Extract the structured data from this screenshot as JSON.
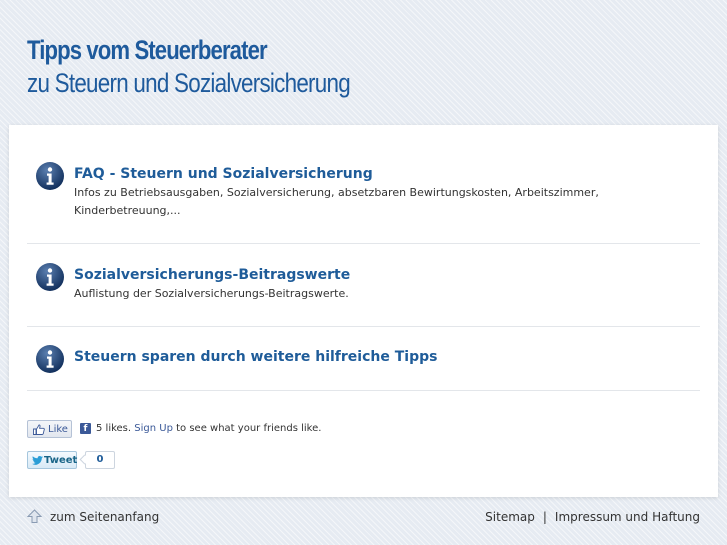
{
  "header": {
    "title_line1": "Tipps vom Steuerberater",
    "title_line2": "zu Steuern und Sozialversicherung"
  },
  "entries": [
    {
      "title": "FAQ - Steuern und Sozialversicherung",
      "description": "Infos zu Betriebsausgaben, Sozialversicherung, absetzbaren Bewirtungskosten, Arbeitszimmer, Kinderbetreuung,..."
    },
    {
      "title": "Sozialversicherungs-Beitragswerte",
      "description": "Auflistung der Sozialversicherungs-Beitragswerte."
    },
    {
      "title": "Steuern sparen durch weitere hilfreiche Tipps",
      "description": ""
    }
  ],
  "social": {
    "like_label": "Like",
    "fb_count_text": "5 likes.",
    "fb_signup": "Sign Up",
    "fb_suffix": "to see what your friends like.",
    "tweet_label": "Tweet",
    "tweet_count": "0"
  },
  "footer": {
    "back_to_top": "zum Seitenanfang",
    "sitemap": "Sitemap",
    "separator": "|",
    "imprint": "Impressum und Haftung"
  },
  "colors": {
    "accent": "#1f5c99",
    "facebook": "#3b5998",
    "background": "#e6ebf2"
  },
  "icons": [
    "info-icon",
    "thumbs-up-icon",
    "facebook-icon",
    "twitter-bird-icon",
    "arrow-up-icon"
  ]
}
